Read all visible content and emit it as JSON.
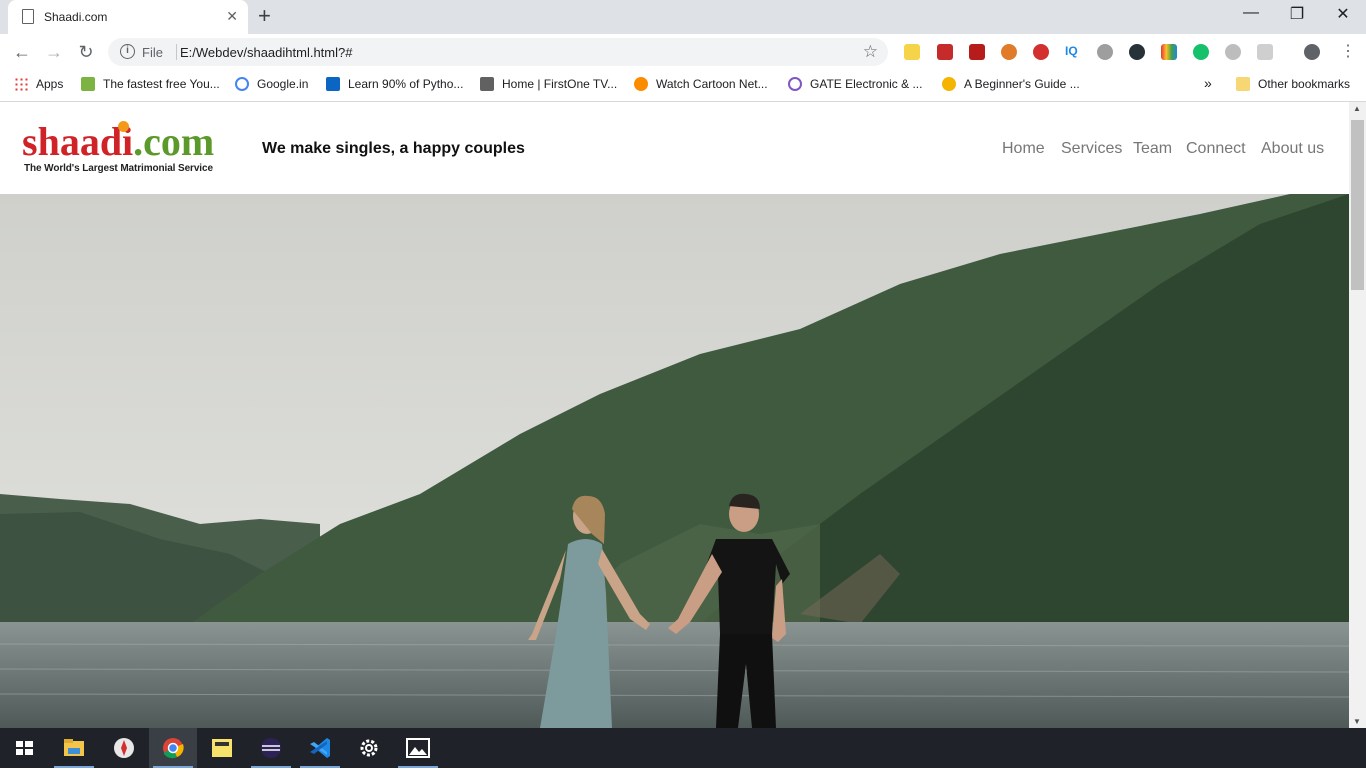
{
  "browser": {
    "tab_title": "Shaadi.com",
    "tab_close": "✕",
    "new_tab": "+",
    "window_min": "—",
    "window_restore": "❐",
    "window_close": "✕",
    "address_scheme": "File",
    "address_url": "E:/Webdev/shaadihtml.html?#",
    "bookmarks": [
      {
        "label": "Apps",
        "icon": "apps-grid-icon"
      },
      {
        "label": "The fastest free You...",
        "icon": "download-arrow-icon"
      },
      {
        "label": "Google.in",
        "icon": "google-icon"
      },
      {
        "label": "Learn 90% of Pytho...",
        "icon": "linkedin-icon"
      },
      {
        "label": "Home | FirstOne TV...",
        "icon": "firstone-tv-icon"
      },
      {
        "label": "Watch Cartoon Net...",
        "icon": "cartoon-icon"
      },
      {
        "label": "GATE Electronic & ...",
        "icon": "gate-icon"
      },
      {
        "label": "A Beginner's Guide ...",
        "icon": "guide-icon"
      }
    ],
    "more_bookmarks": "»",
    "other_bookmarks": "Other bookmarks"
  },
  "site": {
    "logo_text_red": "shaadi",
    "logo_text_green": ".com",
    "logo_subtitle": "The World's Largest Matrimonial Service",
    "tagline": "We make singles, a happy couples",
    "nav": [
      "Home",
      "Services",
      "Team",
      "Connect",
      "About us"
    ]
  },
  "colors": {
    "logo_red": "#d02328",
    "logo_green": "#5b9a2a",
    "logo_dot": "#f39a1b",
    "nav_text": "#777777",
    "taskbar": "#1f2329"
  },
  "taskbar": [
    "windows-start-icon",
    "file-explorer-icon",
    "compass-app-icon",
    "chrome-icon",
    "sticky-notes-icon",
    "eclipse-icon",
    "vscode-icon",
    "settings-gear-icon",
    "photos-icon"
  ]
}
